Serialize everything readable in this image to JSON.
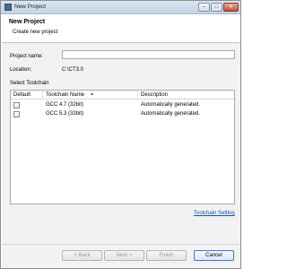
{
  "window": {
    "title": "New Project",
    "minimize_glyph": "–",
    "maximize_glyph": "□",
    "close_glyph": "×"
  },
  "header": {
    "title": "New Project",
    "subtitle": "Create new project"
  },
  "form": {
    "project_name_label": "Project name:",
    "project_name_value": "",
    "location_label": "Location:",
    "location_value": "C:\\CT3.0",
    "toolchain_section_label": "Select Toolchain"
  },
  "table": {
    "columns": [
      "Default",
      "Toolchain Name",
      "Description"
    ],
    "sort_glyph": "▲",
    "rows": [
      {
        "default": false,
        "name": "GCC 4.7 (32bit)",
        "description": "Automatically generated."
      },
      {
        "default": false,
        "name": "GCC 5.3 (32bit)",
        "description": "Automatically generated."
      }
    ]
  },
  "links": {
    "toolchain_setting": "Toolchain Setting"
  },
  "buttons": {
    "back": "< Back",
    "next": "Next >",
    "finish": "Finish",
    "cancel": "Cancel"
  }
}
